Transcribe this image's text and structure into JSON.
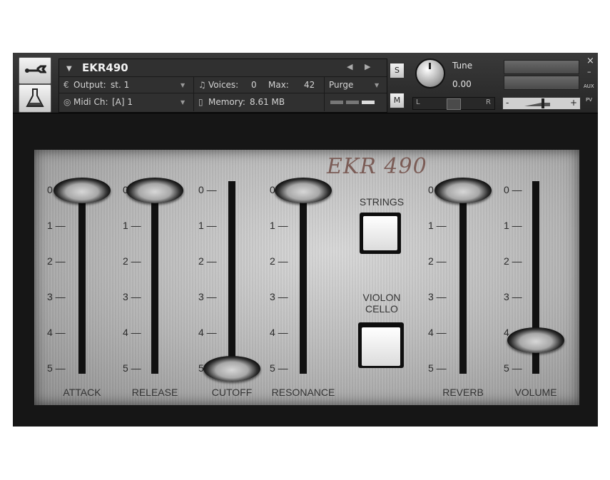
{
  "header": {
    "instrument_name": "EKR490",
    "output_label": "Output:",
    "output_value": "st. 1",
    "voices_label": "Voices:",
    "voices_value": "0",
    "max_label": "Max:",
    "max_value": "42",
    "purge_label": "Purge",
    "midi_label": "Midi Ch:",
    "midi_value": "[A]  1",
    "memory_label": "Memory:",
    "memory_value": "8.61 MB",
    "solo_label": "S",
    "mute_label": "M",
    "tune_label": "Tune",
    "tune_value": "0.00",
    "pan_left": "L",
    "pan_right": "R",
    "vol_minus": "-",
    "vol_plus": "+",
    "close_glyph": "×",
    "minimize_glyph": "–",
    "aux_label": "AUX",
    "pv_label": "PV"
  },
  "panel": {
    "brand": "EKR 490",
    "tick_labels": [
      "0",
      "1",
      "2",
      "3",
      "4",
      "5"
    ],
    "faders": [
      {
        "label": "ATTACK",
        "level": 0
      },
      {
        "label": "RELEASE",
        "level": 0
      },
      {
        "label": "CUTOFF",
        "level": 5
      },
      {
        "label": "RESONANCE",
        "level": 0
      },
      {
        "label": "REVERB",
        "level": 0
      },
      {
        "label": "VOLUME",
        "level": 4.2
      }
    ],
    "buttons": [
      {
        "label_line1": "STRINGS",
        "label_line2": "",
        "pressed": false
      },
      {
        "label_line1": "VIOLON",
        "label_line2": "CELLO",
        "pressed": true
      }
    ]
  },
  "colors": {
    "brand_text": "#7b5c56",
    "panel_metal": "#b4b4b4",
    "header_bg": "#303030"
  }
}
